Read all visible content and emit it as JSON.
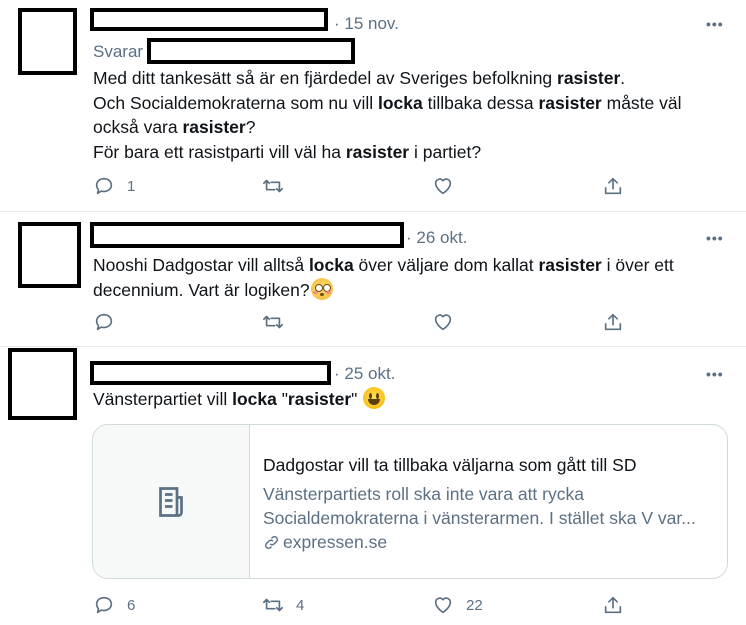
{
  "tweets": [
    {
      "date": "· 15 nov.",
      "reply_label": "Svarar",
      "lines": [
        [
          "Med ditt tankesätt så är en fjärdedel av Sveriges befolkning ",
          "rasister",
          "."
        ],
        [
          "Och Socialdemokraterna som nu vill ",
          "locka",
          " tillbaka dessa ",
          "rasister",
          " måste väl"
        ],
        [
          "också vara ",
          "rasister",
          "?"
        ],
        [
          "För bara ett rasistparti vill väl ha ",
          "rasister",
          " i partiet?"
        ]
      ],
      "reply_count": "1",
      "retweet_count": "",
      "like_count": ""
    },
    {
      "date": "· 26 okt.",
      "lines": [
        [
          "Nooshi Dadgostar vill alltså ",
          "locka",
          " över väljare dom kallat ",
          "rasister",
          " i över ett"
        ],
        [
          "decennium. Vart är logiken?"
        ]
      ],
      "reply_count": "",
      "retweet_count": "",
      "like_count": ""
    },
    {
      "date": "· 25 okt.",
      "lines": [
        [
          "Vänsterpartiet vill ",
          "locka",
          " \"",
          "rasister",
          "\" "
        ]
      ],
      "reply_count": "6",
      "retweet_count": "4",
      "like_count": "22",
      "card": {
        "title": "Dadgostar vill ta tillbaka väljarna som gått till SD",
        "description_line1": "Vänsterpartiets roll ska inte vara att rycka",
        "description_line2": "Socialdemokraterna i vänsterarmen. I stället ska V var...",
        "domain": "expressen.se"
      }
    }
  ],
  "more_label": "•••",
  "icons": [
    "reply-icon",
    "retweet-icon",
    "like-icon",
    "share-icon",
    "article-icon",
    "link-icon",
    "flushed-face-emoji",
    "smiley-emoji"
  ]
}
